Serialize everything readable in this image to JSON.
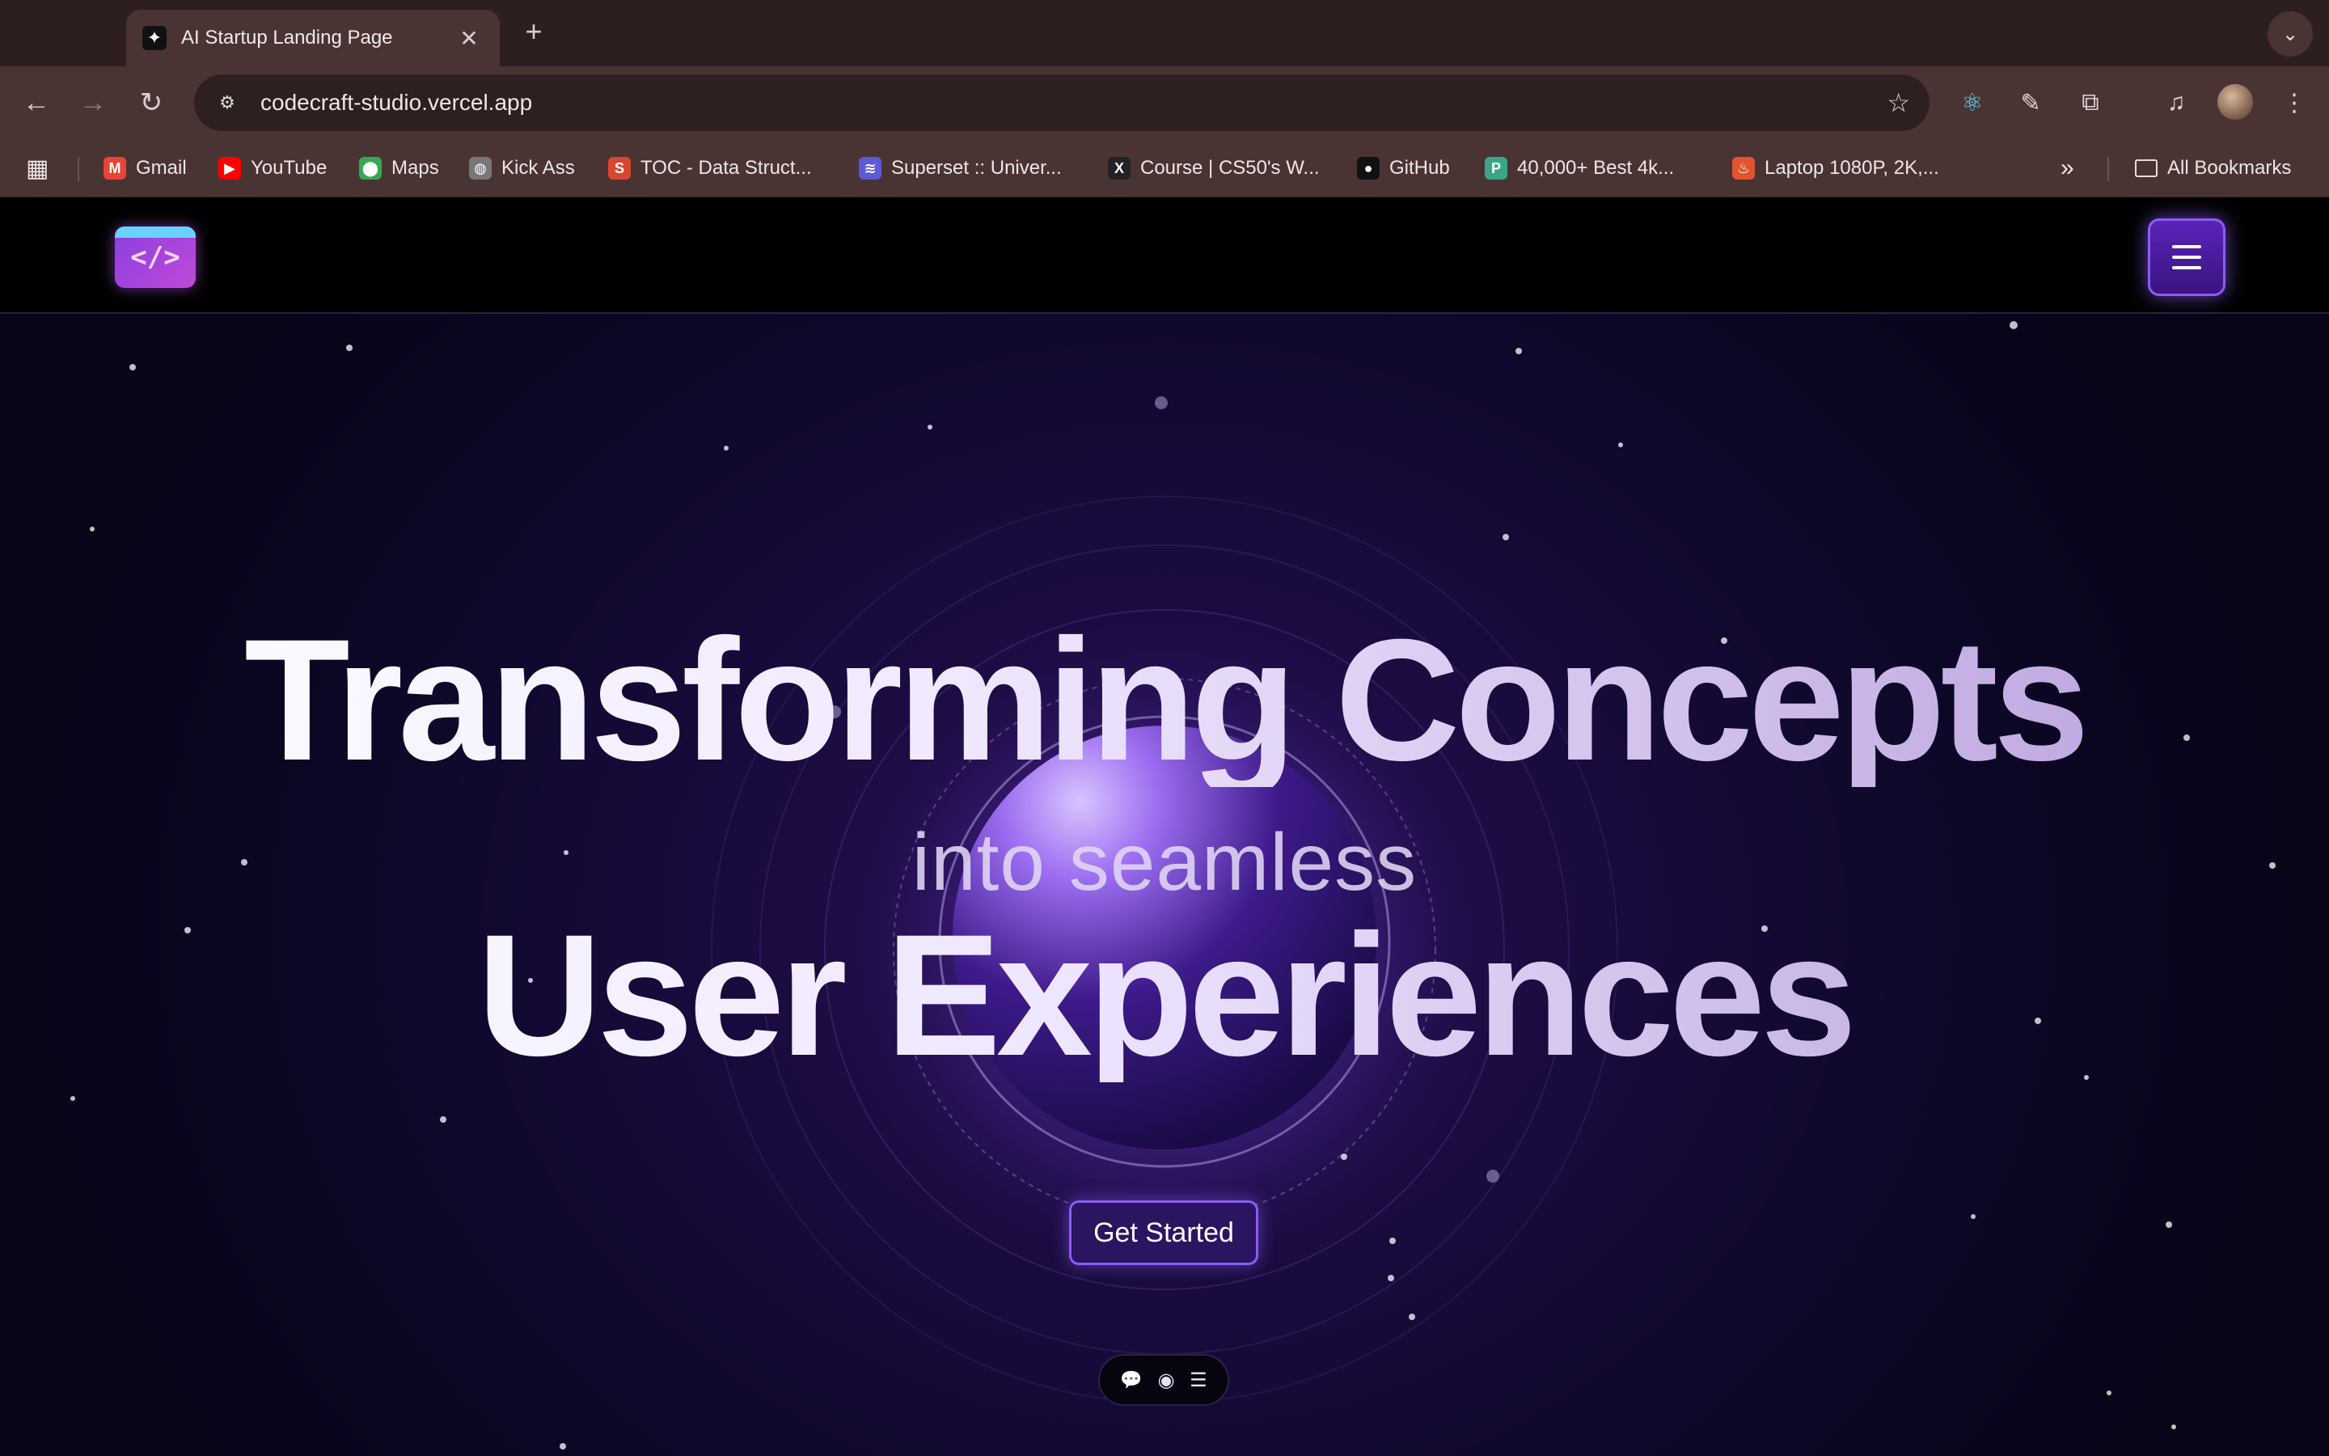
{
  "browser": {
    "tab": {
      "title": "AI Startup Landing Page",
      "favicon": "✦",
      "close": "✕"
    },
    "new_tab": "+",
    "tab_search": "⌄",
    "url": "codecraft-studio.vercel.app",
    "bookmarks": [
      {
        "label": "Gmail",
        "icon": "M",
        "color": "#ea4335"
      },
      {
        "label": "YouTube",
        "icon": "▶",
        "color": "#ff0000"
      },
      {
        "label": "Maps",
        "icon": "⬤",
        "color": "#34a853"
      },
      {
        "label": "Kick Ass",
        "icon": "◍",
        "color": "#777777"
      },
      {
        "label": "TOC - Data Struct...",
        "icon": "S",
        "color": "#d9462f"
      },
      {
        "label": "Superset :: Univer...",
        "icon": "≋",
        "color": "#5b5bd6"
      },
      {
        "label": "Course | CS50's W...",
        "icon": "X",
        "color": "#222222"
      },
      {
        "label": "GitHub",
        "icon": "●",
        "color": "#111111"
      },
      {
        "label": "40,000+ Best 4k...",
        "icon": "P",
        "color": "#3aa683"
      },
      {
        "label": "Laptop 1080P, 2K,...",
        "icon": "♨",
        "color": "#e0542e"
      }
    ],
    "more_bookmarks": "»",
    "all_bookmarks": "All Bookmarks"
  },
  "site": {
    "logo_text": "</>",
    "hero": {
      "line1": "Transforming Concepts",
      "line2": "into seamless",
      "line3": "User Experiences"
    },
    "cta_label": "Get Started",
    "dock": {
      "chat": "💬",
      "eye": "◉",
      "menu": "☰"
    }
  }
}
